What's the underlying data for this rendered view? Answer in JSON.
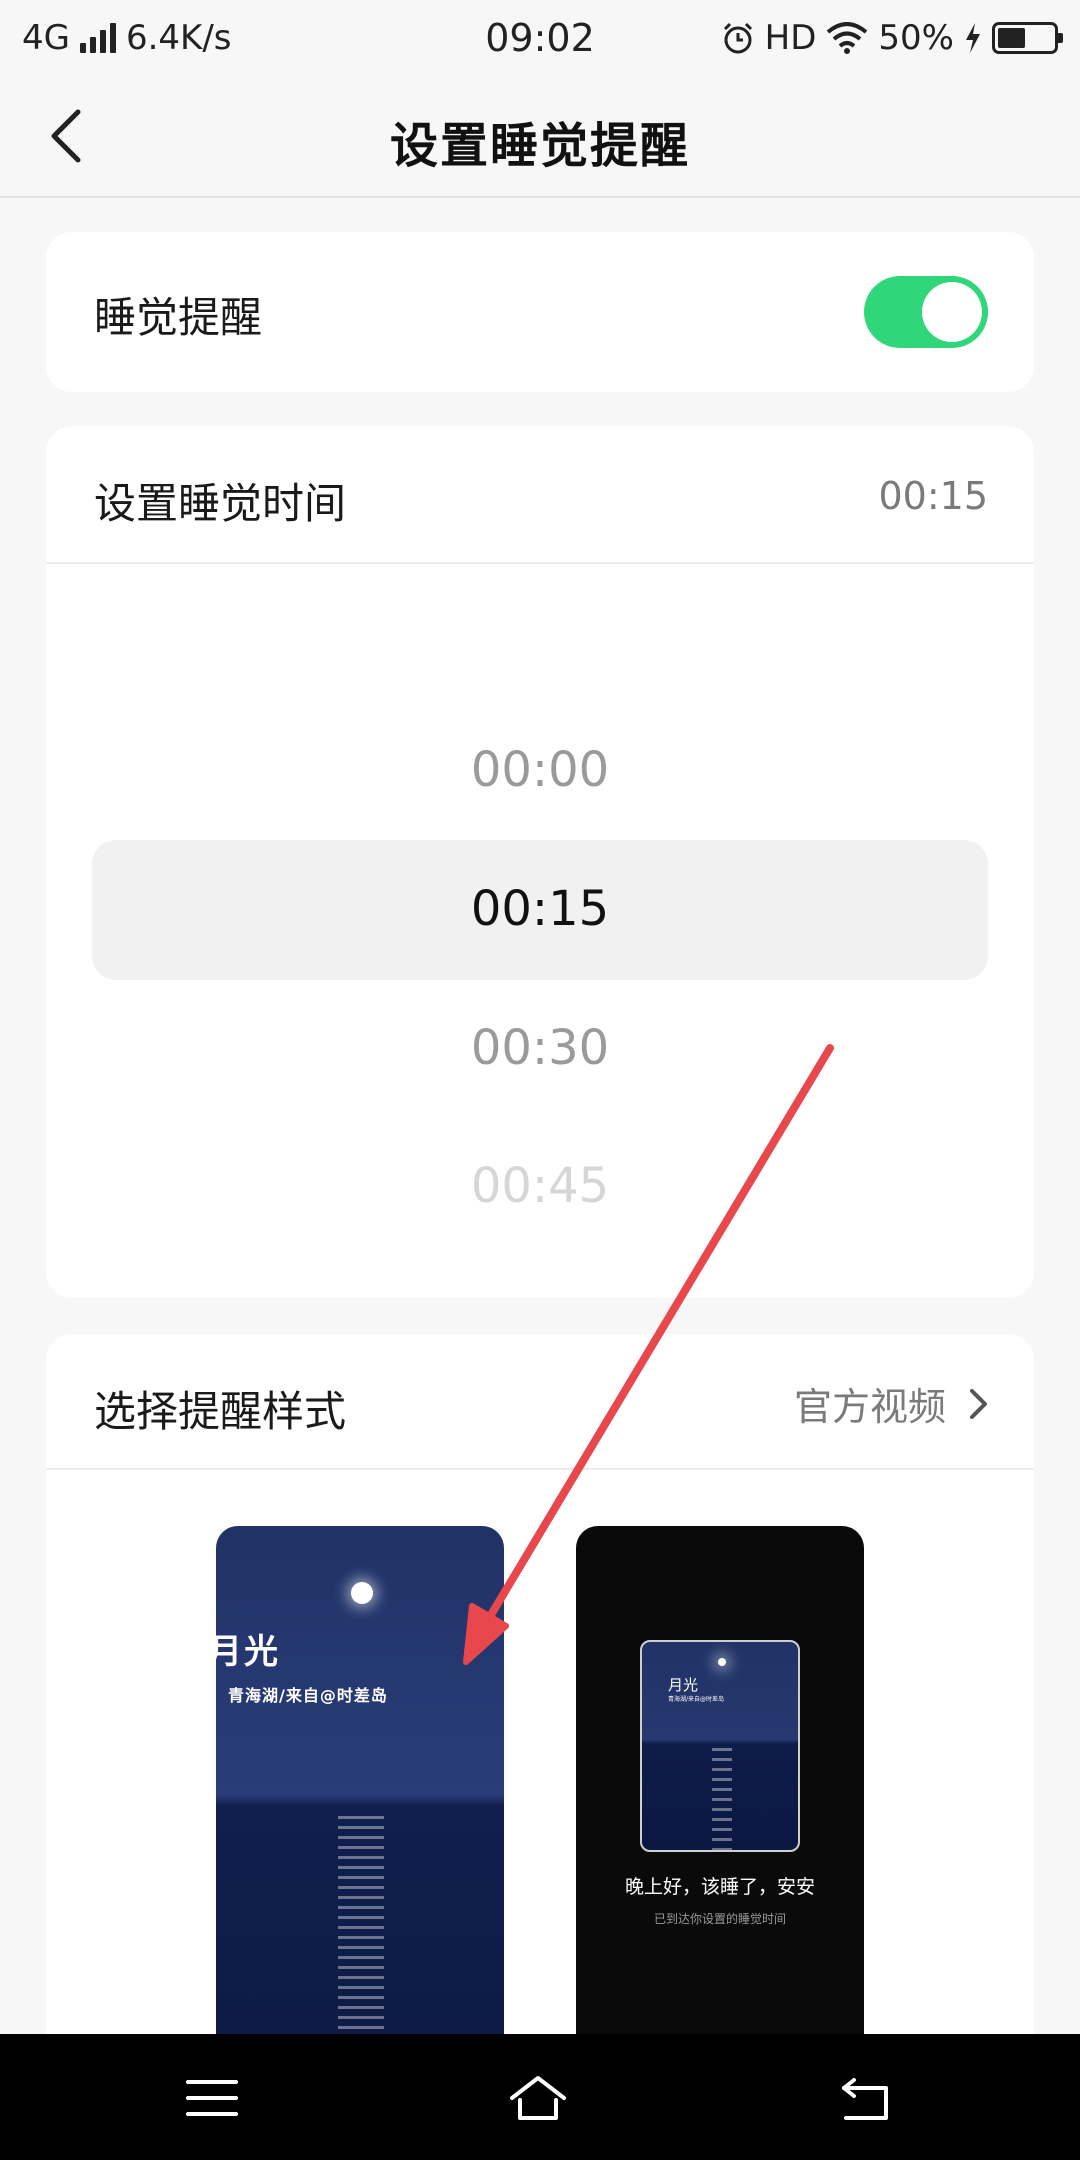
{
  "status_bar": {
    "network": "4G",
    "speed": "6.4K/s",
    "time": "09:02",
    "hd": "HD",
    "battery_percent": "50%",
    "battery_level": 0.5
  },
  "header": {
    "title": "设置睡觉提醒"
  },
  "reminder": {
    "label": "睡觉提醒",
    "enabled": true
  },
  "time_setting": {
    "label": "设置睡觉时间",
    "value": "00:15",
    "options": [
      "00:00",
      "00:15",
      "00:30",
      "00:45"
    ],
    "selected_index": 1
  },
  "style_setting": {
    "label": "选择提醒样式",
    "value": "官方视频"
  },
  "previews": {
    "a": {
      "title": "月光",
      "subtitle": "青海湖/来自@时差岛"
    },
    "b": {
      "mini_title": "月光",
      "mini_subtitle": "青海湖/来自@时差岛",
      "greeting": "晚上好，该睡了，安安",
      "hint": "已到达你设置的睡觉时间"
    }
  },
  "colors": {
    "toggle_on": "#2fd67a",
    "annotation_arrow": "#e8474b"
  }
}
